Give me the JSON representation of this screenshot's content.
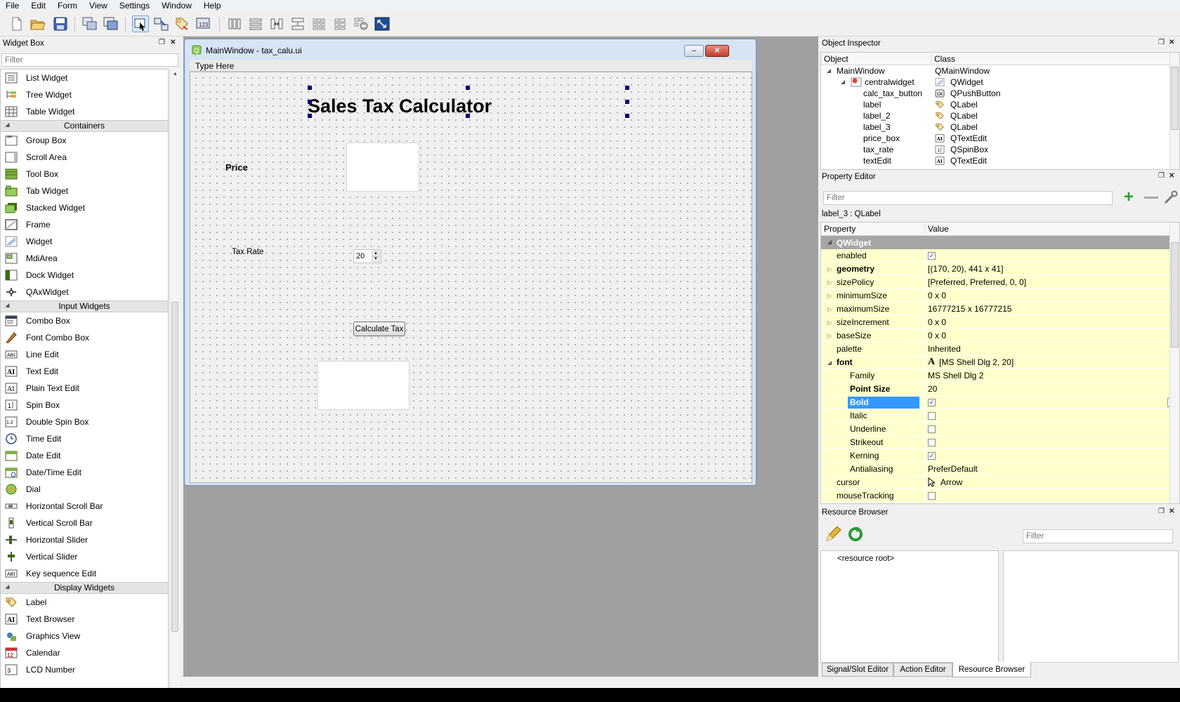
{
  "menu": [
    "File",
    "Edit",
    "Form",
    "View",
    "Settings",
    "Window",
    "Help"
  ],
  "widget_box": {
    "title": "Widget Box",
    "filter_placeholder": "Filter",
    "items": [
      {
        "type": "item",
        "label": "List Widget",
        "icon": "list-widget-icon"
      },
      {
        "type": "item",
        "label": "Tree Widget",
        "icon": "tree-widget-icon"
      },
      {
        "type": "item",
        "label": "Table Widget",
        "icon": "table-widget-icon"
      },
      {
        "type": "cat",
        "label": "Containers"
      },
      {
        "type": "item",
        "label": "Group Box",
        "icon": "group-box-icon"
      },
      {
        "type": "item",
        "label": "Scroll Area",
        "icon": "scroll-area-icon"
      },
      {
        "type": "item",
        "label": "Tool Box",
        "icon": "tool-box-icon"
      },
      {
        "type": "item",
        "label": "Tab Widget",
        "icon": "tab-widget-icon"
      },
      {
        "type": "item",
        "label": "Stacked Widget",
        "icon": "stacked-widget-icon"
      },
      {
        "type": "item",
        "label": "Frame",
        "icon": "frame-icon"
      },
      {
        "type": "item",
        "label": "Widget",
        "icon": "widget-icon"
      },
      {
        "type": "item",
        "label": "MdiArea",
        "icon": "mdi-area-icon"
      },
      {
        "type": "item",
        "label": "Dock Widget",
        "icon": "dock-widget-icon"
      },
      {
        "type": "item",
        "label": "QAxWidget",
        "icon": "qax-widget-icon"
      },
      {
        "type": "cat",
        "label": "Input Widgets"
      },
      {
        "type": "item",
        "label": "Combo Box",
        "icon": "combo-box-icon"
      },
      {
        "type": "item",
        "label": "Font Combo Box",
        "icon": "font-combo-box-icon"
      },
      {
        "type": "item",
        "label": "Line Edit",
        "icon": "line-edit-icon"
      },
      {
        "type": "item",
        "label": "Text Edit",
        "icon": "text-edit-icon"
      },
      {
        "type": "item",
        "label": "Plain Text Edit",
        "icon": "plain-text-edit-icon"
      },
      {
        "type": "item",
        "label": "Spin Box",
        "icon": "spin-box-icon"
      },
      {
        "type": "item",
        "label": "Double Spin Box",
        "icon": "double-spin-box-icon"
      },
      {
        "type": "item",
        "label": "Time Edit",
        "icon": "time-edit-icon"
      },
      {
        "type": "item",
        "label": "Date Edit",
        "icon": "date-edit-icon"
      },
      {
        "type": "item",
        "label": "Date/Time Edit",
        "icon": "date-time-edit-icon"
      },
      {
        "type": "item",
        "label": "Dial",
        "icon": "dial-icon"
      },
      {
        "type": "item",
        "label": "Horizontal Scroll Bar",
        "icon": "horizontal-scroll-bar-icon"
      },
      {
        "type": "item",
        "label": "Vertical Scroll Bar",
        "icon": "vertical-scroll-bar-icon"
      },
      {
        "type": "item",
        "label": "Horizontal Slider",
        "icon": "horizontal-slider-icon"
      },
      {
        "type": "item",
        "label": "Vertical Slider",
        "icon": "vertical-slider-icon"
      },
      {
        "type": "item",
        "label": "Key sequence Edit",
        "icon": "key-sequence-edit-icon"
      },
      {
        "type": "cat",
        "label": "Display Widgets"
      },
      {
        "type": "item",
        "label": "Label",
        "icon": "label-icon"
      },
      {
        "type": "item",
        "label": "Text Browser",
        "icon": "text-browser-icon"
      },
      {
        "type": "item",
        "label": "Graphics View",
        "icon": "graphics-view-icon"
      },
      {
        "type": "item",
        "label": "Calendar",
        "icon": "calendar-icon"
      },
      {
        "type": "item",
        "label": "LCD Number",
        "icon": "lcd-number-icon"
      }
    ]
  },
  "form_window": {
    "title": "MainWindow - tax_calu.ui",
    "type_here": "Type Here",
    "heading": "Sales Tax Calculator",
    "price_label": "Price",
    "tax_rate_label": "Tax Rate",
    "tax_rate_value": "20",
    "calc_button": "Calculate Tax"
  },
  "object_inspector": {
    "title": "Object Inspector",
    "col_object": "Object",
    "col_class": "Class",
    "rows": [
      {
        "object": "MainWindow",
        "class": "QMainWindow",
        "indent": 0,
        "icon": ""
      },
      {
        "object": "centralwidget",
        "class": "QWidget",
        "indent": 1,
        "icon": "widget-icon"
      },
      {
        "object": "calc_tax_button",
        "class": "QPushButton",
        "indent": 2,
        "icon": "push-button-icon"
      },
      {
        "object": "label",
        "class": "QLabel",
        "indent": 2,
        "icon": "label-icon"
      },
      {
        "object": "label_2",
        "class": "QLabel",
        "indent": 2,
        "icon": "label-icon"
      },
      {
        "object": "label_3",
        "class": "QLabel",
        "indent": 2,
        "icon": "label-icon"
      },
      {
        "object": "price_box",
        "class": "QTextEdit",
        "indent": 2,
        "icon": "text-edit-icon"
      },
      {
        "object": "tax_rate",
        "class": "QSpinBox",
        "indent": 2,
        "icon": "spin-box-icon"
      },
      {
        "object": "textEdit",
        "class": "QTextEdit",
        "indent": 2,
        "icon": "text-edit-icon"
      }
    ]
  },
  "property_editor": {
    "title": "Property Editor",
    "filter_placeholder": "Filter",
    "selected_object": "label_3 : QLabel",
    "col_property": "Property",
    "col_value": "Value",
    "section": "QWidget",
    "rows": [
      {
        "name": "enabled",
        "value": "",
        "check": true,
        "level": 0,
        "bold": false,
        "expand": ""
      },
      {
        "name": "geometry",
        "value": "[(170, 20), 441 x 41]",
        "level": 0,
        "bold": true,
        "expand": "collapsed"
      },
      {
        "name": "sizePolicy",
        "value": "[Preferred, Preferred, 0, 0]",
        "level": 0,
        "bold": false,
        "expand": "collapsed"
      },
      {
        "name": "minimumSize",
        "value": "0 x 0",
        "level": 0,
        "bold": false,
        "expand": "collapsed"
      },
      {
        "name": "maximumSize",
        "value": "16777215 x 16777215",
        "level": 0,
        "bold": false,
        "expand": "collapsed"
      },
      {
        "name": "sizeIncrement",
        "value": "0 x 0",
        "level": 0,
        "bold": false,
        "expand": "collapsed"
      },
      {
        "name": "baseSize",
        "value": "0 x 0",
        "level": 0,
        "bold": false,
        "expand": "collapsed"
      },
      {
        "name": "palette",
        "value": "Inherited",
        "level": 0,
        "bold": false,
        "expand": ""
      },
      {
        "name": "font",
        "value": "[MS Shell Dlg 2, 20]",
        "level": 0,
        "bold": true,
        "expand": "expanded",
        "fonticon": true
      },
      {
        "name": "Family",
        "value": "MS Shell Dlg 2",
        "level": 1,
        "bold": false,
        "expand": ""
      },
      {
        "name": "Point Size",
        "value": "20",
        "level": 1,
        "bold": true,
        "expand": ""
      },
      {
        "name": "Bold",
        "value": "",
        "check": true,
        "level": 1,
        "bold": true,
        "expand": "",
        "selected": true
      },
      {
        "name": "Italic",
        "value": "",
        "check": false,
        "level": 1,
        "bold": false,
        "expand": ""
      },
      {
        "name": "Underline",
        "value": "",
        "check": false,
        "level": 1,
        "bold": false,
        "expand": ""
      },
      {
        "name": "Strikeout",
        "value": "",
        "check": false,
        "level": 1,
        "bold": false,
        "expand": ""
      },
      {
        "name": "Kerning",
        "value": "",
        "check": true,
        "level": 1,
        "bold": false,
        "expand": ""
      },
      {
        "name": "Antialiasing",
        "value": "PreferDefault",
        "level": 1,
        "bold": false,
        "expand": ""
      },
      {
        "name": "cursor",
        "value": "Arrow",
        "level": 0,
        "bold": false,
        "expand": "",
        "cursoricon": true
      },
      {
        "name": "mouseTracking",
        "value": "",
        "check": false,
        "level": 0,
        "bold": false,
        "expand": ""
      }
    ]
  },
  "resource_browser": {
    "title": "Resource Browser",
    "filter_placeholder": "Filter",
    "root": "<resource root>"
  },
  "bottom_tabs": [
    "Signal/Slot Editor",
    "Action Editor",
    "Resource Browser"
  ],
  "colors": {
    "prop_yellow": "#ffffcc",
    "prop_section": "#a6a6a6",
    "selection": "#3399ff",
    "mdi_bg": "#a0a0a0"
  }
}
